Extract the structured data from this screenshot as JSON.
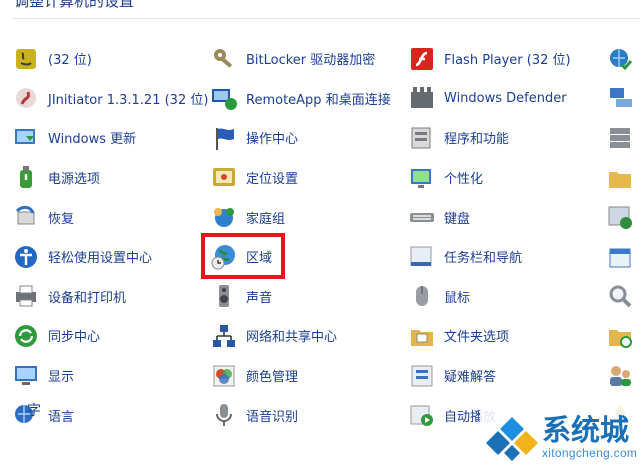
{
  "header": {
    "title": "调整计算机的设置"
  },
  "rows": [
    [
      {
        "label": "(32 位)",
        "icon": "java-icon",
        "icon_color": "#c9b21b"
      },
      {
        "label": "BitLocker 驱动器加密",
        "icon": "bitlocker-key-icon",
        "icon_color": "#9a8a5a"
      },
      {
        "label": "Flash Player (32 位)",
        "icon": "flash-player-icon",
        "icon_color": "#d8251e"
      },
      {
        "label": "",
        "icon": "globe-check-icon",
        "icon_color": "#2c7cc1"
      }
    ],
    [
      {
        "label": "JInitiator 1.3.1.21 (32 位)",
        "icon": "jinitiator-icon",
        "icon_color": "#b23a3a"
      },
      {
        "label": "RemoteApp 和桌面连接",
        "icon": "remoteapp-icon",
        "icon_color": "#2456a8"
      },
      {
        "label": "Windows Defender",
        "icon": "windows-defender-icon",
        "icon_color": "#666b70"
      },
      {
        "label": "",
        "icon": "devices-icon",
        "icon_color": "#3b77c4"
      }
    ],
    [
      {
        "label": "Windows 更新",
        "icon": "windows-update-icon",
        "icon_color": "#2a9a3c"
      },
      {
        "label": "操作中心",
        "icon": "action-center-flag-icon",
        "icon_color": "#2a5cb8"
      },
      {
        "label": "程序和功能",
        "icon": "programs-features-icon",
        "icon_color": "#777b80"
      },
      {
        "label": "",
        "icon": "server-stack-icon",
        "icon_color": "#8a8f96"
      }
    ],
    [
      {
        "label": "电源选项",
        "icon": "power-options-icon",
        "icon_color": "#3a9b3a"
      },
      {
        "label": "定位设置",
        "icon": "location-settings-icon",
        "icon_color": "#c9a83a"
      },
      {
        "label": "个性化",
        "icon": "personalization-icon",
        "icon_color": "#3a78c4"
      },
      {
        "label": "",
        "icon": "folder-icon",
        "icon_color": "#e6b94a"
      }
    ],
    [
      {
        "label": "恢复",
        "icon": "recovery-icon",
        "icon_color": "#2f6fc0"
      },
      {
        "label": "家庭组",
        "icon": "homegroup-icon",
        "icon_color": "#2e7fd0"
      },
      {
        "label": "键盘",
        "icon": "keyboard-icon",
        "icon_color": "#8a8f96"
      },
      {
        "label": "",
        "icon": "window-check-icon",
        "icon_color": "#2f8e3a"
      }
    ],
    [
      {
        "label": "轻松使用设置中心",
        "icon": "ease-of-access-icon",
        "icon_color": "#2468c4"
      },
      {
        "label": "区域",
        "icon": "region-globe-clock-icon",
        "icon_color": "#2c8a3e"
      },
      {
        "label": "任务栏和导航",
        "icon": "taskbar-navigation-icon",
        "icon_color": "#3a66b2"
      },
      {
        "label": "",
        "icon": "calendar-icon",
        "icon_color": "#3d7bc8"
      }
    ],
    [
      {
        "label": "设备和打印机",
        "icon": "devices-printers-icon",
        "icon_color": "#6d7278"
      },
      {
        "label": "声音",
        "icon": "sound-icon",
        "icon_color": "#8a8f96"
      },
      {
        "label": "鼠标",
        "icon": "mouse-icon",
        "icon_color": "#9a9ea4"
      },
      {
        "label": "",
        "icon": "magnifier-icon",
        "icon_color": "#8a8f96"
      }
    ],
    [
      {
        "label": "同步中心",
        "icon": "sync-center-icon",
        "icon_color": "#2e9a3c"
      },
      {
        "label": "网络和共享中心",
        "icon": "network-sharing-icon",
        "icon_color": "#2a56a8"
      },
      {
        "label": "文件夹选项",
        "icon": "folder-options-icon",
        "icon_color": "#e2b64c"
      },
      {
        "label": "",
        "icon": "folder-clock-icon",
        "icon_color": "#e2b64c"
      }
    ],
    [
      {
        "label": "显示",
        "icon": "display-icon",
        "icon_color": "#2f72c6"
      },
      {
        "label": "颜色管理",
        "icon": "color-management-icon",
        "icon_color": "#d44b2a"
      },
      {
        "label": "疑难解答",
        "icon": "troubleshooting-icon",
        "icon_color": "#3a70c0"
      },
      {
        "label": "",
        "icon": "user-accounts-icon",
        "icon_color": "#5c7aa6"
      }
    ],
    [
      {
        "label": "语言",
        "icon": "language-icon",
        "icon_color": "#2e6cc2"
      },
      {
        "label": "语音识别",
        "icon": "speech-recognition-icon",
        "icon_color": "#8a8f96"
      },
      {
        "label": "自动播放",
        "icon": "autoplay-icon",
        "icon_color": "#2e9a3c"
      },
      {
        "label": "",
        "icon": "pen-icon",
        "icon_color": "#d0a43c"
      }
    ]
  ],
  "highlight": {
    "target": "区域",
    "color": "#e8141c"
  },
  "watermark": {
    "text_cn": "系统城",
    "text_en": "xitongcheng.com",
    "color": "#1a6fb5"
  }
}
